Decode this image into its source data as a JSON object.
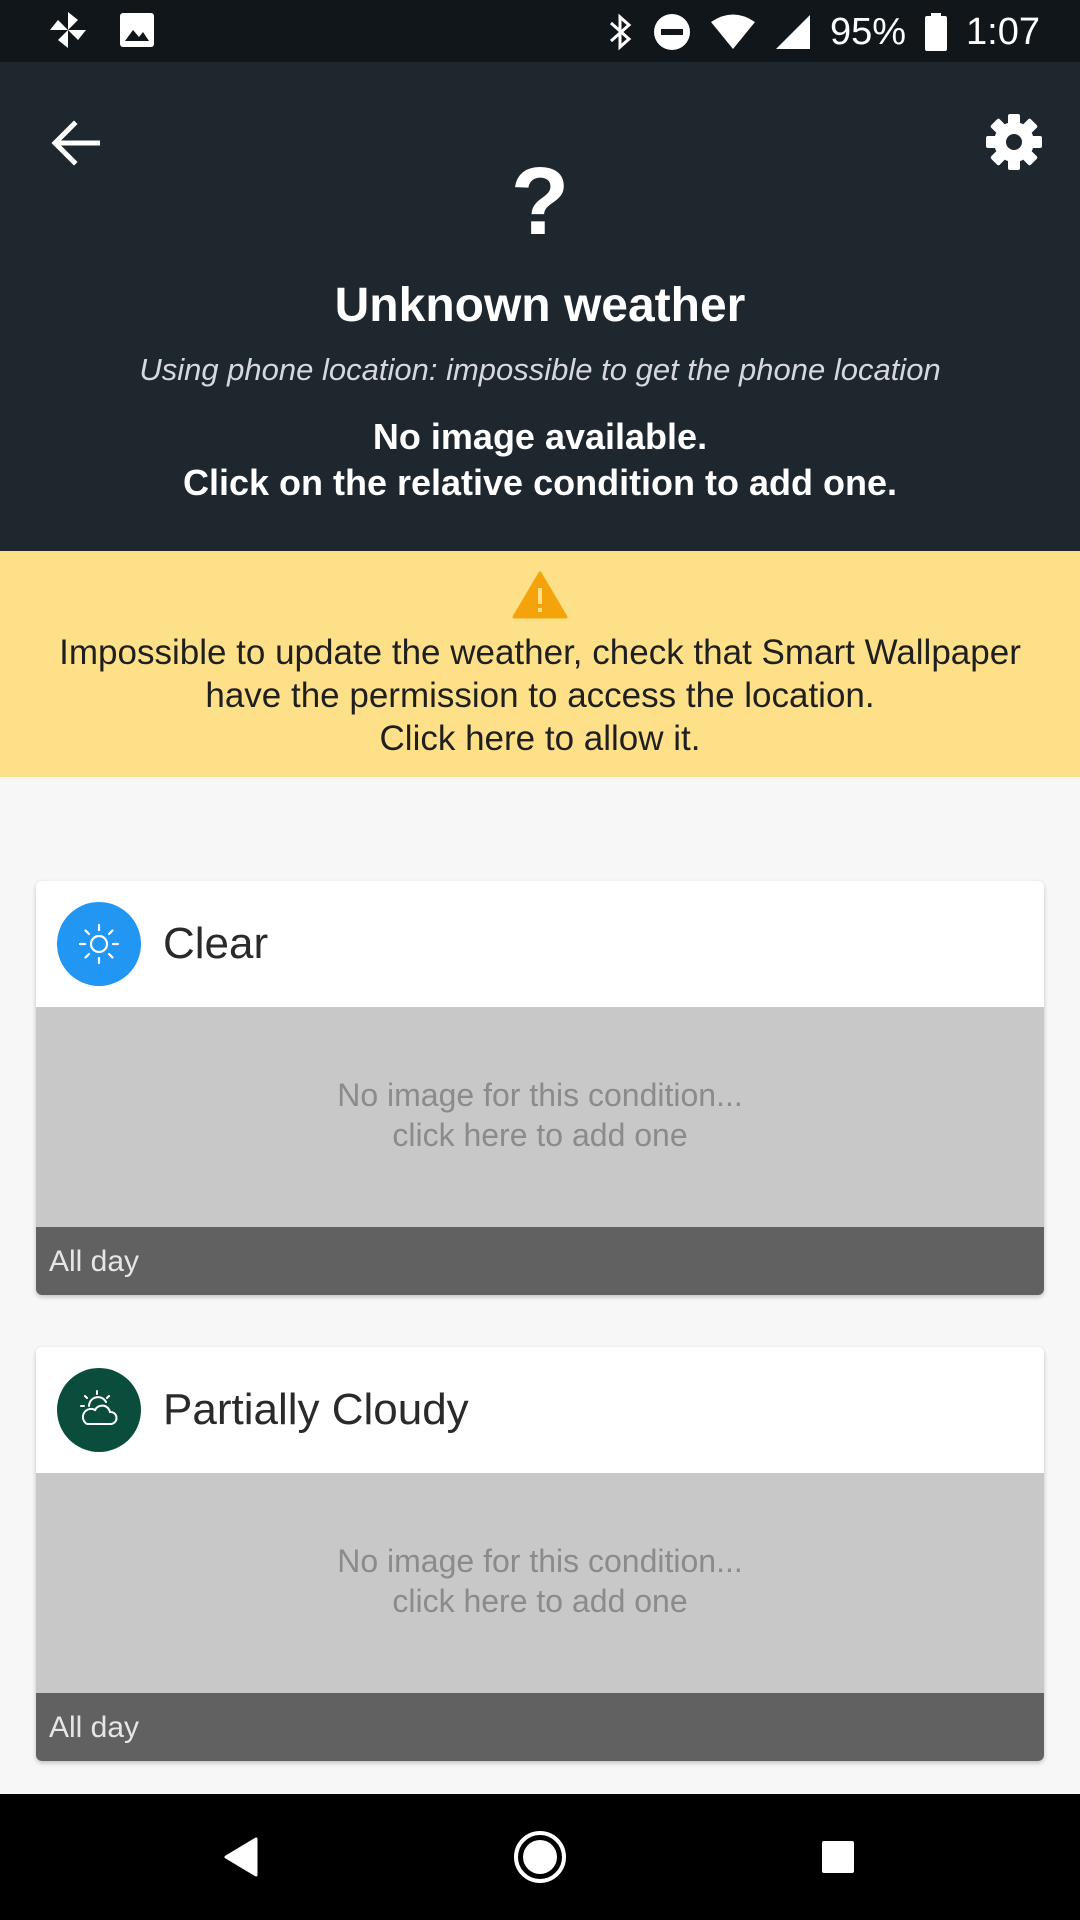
{
  "status_bar": {
    "battery": "95%",
    "time": "1:07"
  },
  "header": {
    "question_mark": "?",
    "title": "Unknown weather",
    "subtitle": "Using phone location: impossible to get the phone location",
    "no_image_line1": "No image available.",
    "no_image_line2": "Click on the relative condition to add one."
  },
  "warning": {
    "line1": "Impossible to update the weather, check that Smart Wallpaper",
    "line2": "have the permission to access the location.",
    "line3": "Click here to allow it."
  },
  "conditions": [
    {
      "label": "Clear",
      "icon": "sun-icon",
      "icon_color": "#2196f3",
      "message_line1": "No image for this condition...",
      "message_line2": "click here to add one",
      "schedule": "All day"
    },
    {
      "label": "Partially Cloudy",
      "icon": "partly-cloudy-icon",
      "icon_color": "#0b4d3c",
      "message_line1": "No image for this condition...",
      "message_line2": "click here to add one",
      "schedule": "All day"
    }
  ],
  "colors": {
    "header_bg": "#1e262e",
    "warning_bg": "#fde088",
    "warning_icon": "#f5a30a"
  }
}
